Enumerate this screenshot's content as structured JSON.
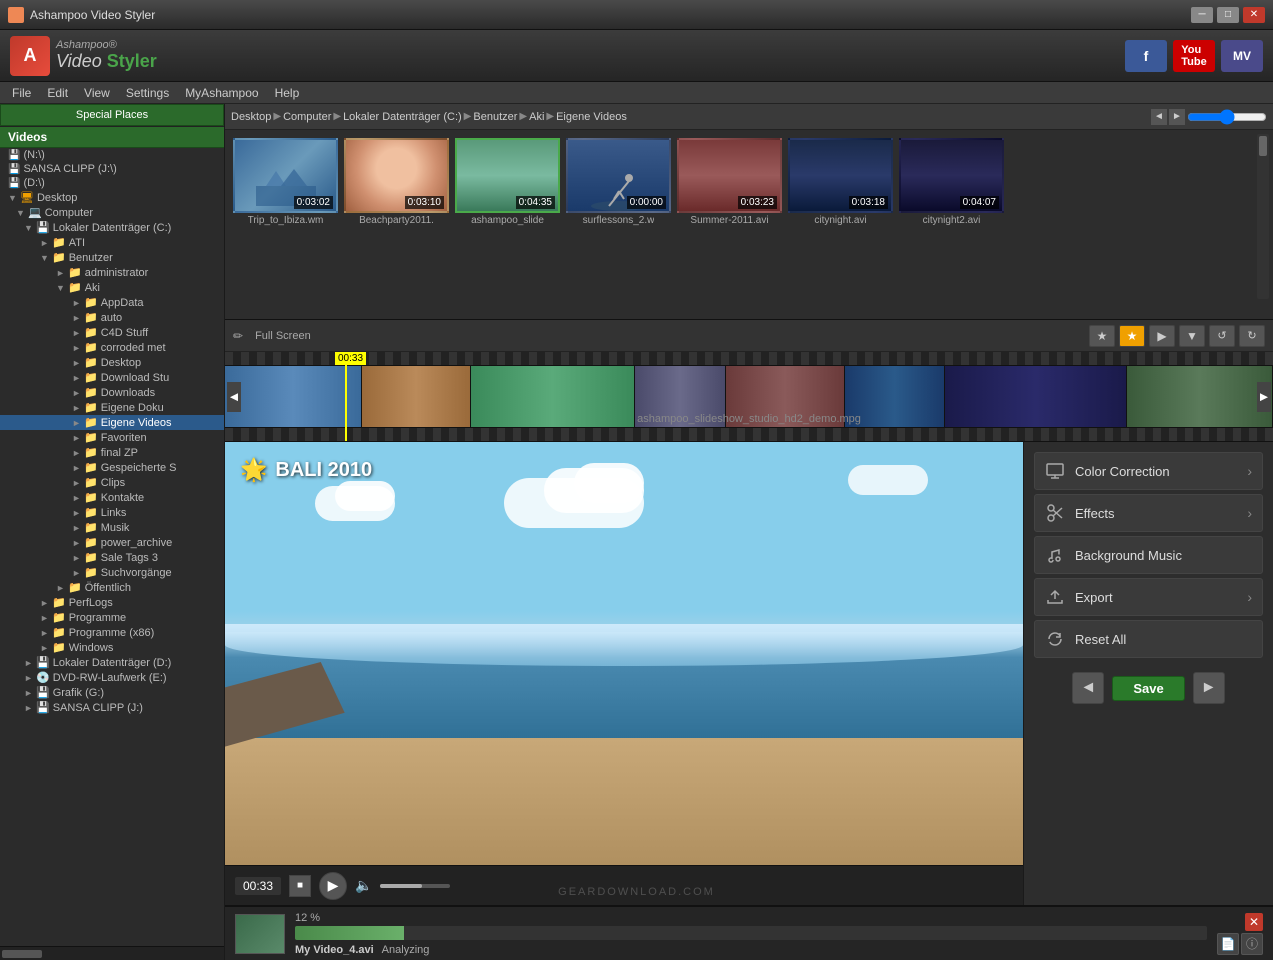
{
  "app": {
    "title": "Ashampoo Video Styler",
    "name": "Video Styler"
  },
  "titlebar": {
    "title": "Ashampoo Video Styler",
    "min": "─",
    "max": "□",
    "close": "✕"
  },
  "menubar": {
    "items": [
      "File",
      "Edit",
      "View",
      "Settings",
      "MyAshampoo",
      "Help"
    ]
  },
  "sidebar": {
    "special_places_tab": "Special Places",
    "videos_label": "Videos",
    "drives": [
      {
        "label": "(N:\\)",
        "indent": 8
      },
      {
        "label": "SANSA CLIPP (J:\\)",
        "indent": 8
      },
      {
        "label": "(D:\\)",
        "indent": 8
      }
    ],
    "tree": [
      {
        "label": "Desktop",
        "indent": 8,
        "expanded": true
      },
      {
        "label": "Computer",
        "indent": 16,
        "expanded": true
      },
      {
        "label": "Lokaler Datenträger (C:)",
        "indent": 24,
        "expanded": true
      },
      {
        "label": "ATI",
        "indent": 40
      },
      {
        "label": "Benutzer",
        "indent": 40,
        "expanded": true
      },
      {
        "label": "administrator",
        "indent": 56
      },
      {
        "label": "Aki",
        "indent": 56,
        "expanded": true
      },
      {
        "label": "AppData",
        "indent": 72
      },
      {
        "label": "auto",
        "indent": 72
      },
      {
        "label": "C4D Stuff",
        "indent": 72
      },
      {
        "label": "corroded met",
        "indent": 72
      },
      {
        "label": "Desktop",
        "indent": 72
      },
      {
        "label": "Download Stu",
        "indent": 72
      },
      {
        "label": "Downloads",
        "indent": 72
      },
      {
        "label": "Eigene Doku",
        "indent": 72
      },
      {
        "label": "Eigene Videos",
        "indent": 72,
        "selected": true
      },
      {
        "label": "Favoriten",
        "indent": 72
      },
      {
        "label": "final ZP",
        "indent": 72
      },
      {
        "label": "Gespeicherte S",
        "indent": 72
      },
      {
        "label": "Clips",
        "indent": 72
      },
      {
        "label": "Kontakte",
        "indent": 72
      },
      {
        "label": "Links",
        "indent": 72
      },
      {
        "label": "Musik",
        "indent": 72
      },
      {
        "label": "power_archive",
        "indent": 72
      },
      {
        "label": "Sale Tags 3",
        "indent": 72
      },
      {
        "label": "Suchvorgänge",
        "indent": 72
      },
      {
        "label": "Öffentlich",
        "indent": 56
      },
      {
        "label": "PerfLogs",
        "indent": 40
      },
      {
        "label": "Programme",
        "indent": 40
      },
      {
        "label": "Programme (x86)",
        "indent": 40
      },
      {
        "label": "Windows",
        "indent": 40
      },
      {
        "label": "Lokaler Datenträger (D:)",
        "indent": 24
      },
      {
        "label": "DVD-RW-Laufwerk (E:)",
        "indent": 24
      },
      {
        "label": "Grafik (G:)",
        "indent": 24
      },
      {
        "label": "SANSA CLIPP (J:)",
        "indent": 24
      }
    ]
  },
  "breadcrumb": {
    "items": [
      "Desktop",
      "Computer",
      "Lokaler Datenträger (C:)",
      "Benutzer",
      "Aki",
      "Eigene Videos"
    ]
  },
  "thumbnails": [
    {
      "label": "Trip_to_Ibiza.wm",
      "time": "0:03:02",
      "class": "tb1"
    },
    {
      "label": "Beachparty2011.",
      "time": "0:03:10",
      "class": "tb2"
    },
    {
      "label": "ashampoo_slide",
      "time": "0:04:35",
      "class": "tb3",
      "selected": true
    },
    {
      "label": "surflessons_2.w",
      "time": "0:00:00",
      "class": "tb4"
    },
    {
      "label": "Summer-2011.avi",
      "time": "0:03:23",
      "class": "tb5"
    },
    {
      "label": "citynight.avi",
      "time": "0:03:18",
      "class": "tb6"
    },
    {
      "label": "citynight2.avi",
      "time": "0:04:07",
      "class": "tb7"
    }
  ],
  "timeline": {
    "fullscreen_label": "Full Screen",
    "cursor_time": "00:33",
    "filename": "ashampoo_slideshow_studio_hd2_demo.mpg",
    "clips": [
      {
        "class": "tc1"
      },
      {
        "class": "tc2"
      },
      {
        "class": "tc3"
      },
      {
        "class": "tc4"
      },
      {
        "class": "tc5"
      },
      {
        "class": "tc6"
      },
      {
        "class": "tc7"
      },
      {
        "class": "tc8"
      }
    ]
  },
  "video": {
    "title": "BALI 2010",
    "time": "00:33"
  },
  "right_panel": {
    "buttons": [
      {
        "label": "Color Correction",
        "icon": "🖥",
        "has_arrow": true
      },
      {
        "label": "Effects",
        "icon": "✂",
        "has_arrow": true
      },
      {
        "label": "Background Music",
        "icon": "🎵",
        "has_arrow": false
      },
      {
        "label": "Export",
        "icon": "📤",
        "has_arrow": true
      },
      {
        "label": "Reset All",
        "icon": "↺",
        "has_arrow": false
      }
    ],
    "save_label": "Save",
    "nav_prev": "◄",
    "nav_next": "►"
  },
  "status_bar": {
    "progress_percent": "12 %",
    "filename": "My Video_4.avi",
    "action": "Analyzing",
    "close": "✕",
    "file_icon": "📄",
    "info_icon": "ⓘ"
  },
  "watermark": "GEARDOWNLOAD.COM"
}
